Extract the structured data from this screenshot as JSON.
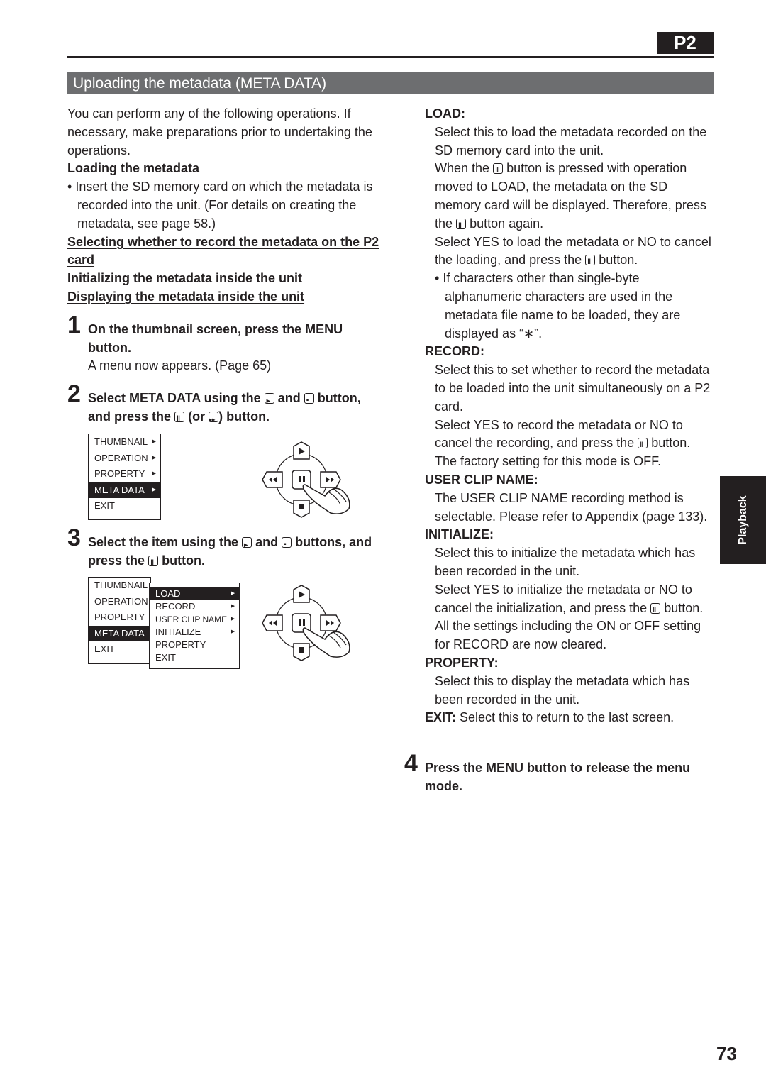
{
  "header": {
    "badge": "P2",
    "section_title": "Uploading the metadata (META DATA)"
  },
  "left": {
    "intro": "You can perform any of the following operations. If necessary, make preparations prior to undertaking the operations.",
    "topics": {
      "loading": "Loading the metadata",
      "loading_bullet": "Insert the SD memory card on which the metadata is recorded into the unit. (For details on creating the metadata, see page 58.)",
      "selecting": "Selecting whether to record the metadata on the P2 card",
      "initializing": "Initializing the metadata inside the unit",
      "displaying": "Displaying the metadata inside the unit"
    },
    "steps": [
      {
        "num": "1",
        "text": "On the thumbnail screen, press the MENU button.",
        "sub": "A menu now appears. (Page 65)"
      },
      {
        "num": "2",
        "text_a": "Select META DATA using the",
        "text_b": "and",
        "text_c": "button, and press the",
        "text_d": "(or",
        "text_e": ") button."
      },
      {
        "num": "3",
        "text_a": "Select the item using the",
        "text_b": "and",
        "text_c": "buttons, and press the",
        "text_d": "button."
      }
    ],
    "menu1": {
      "items": [
        {
          "label": "THUMBNAIL",
          "arrow": "►",
          "selected": false
        },
        {
          "label": "OPERATION",
          "arrow": "►",
          "selected": false
        },
        {
          "label": "PROPERTY",
          "arrow": "►",
          "selected": false
        },
        {
          "label": "META DATA",
          "arrow": "►",
          "selected": true
        },
        {
          "label": "EXIT",
          "arrow": "",
          "selected": false
        }
      ]
    },
    "menu2": {
      "parent": [
        "THUMBNAIL",
        "OPERATION",
        "PROPERTY",
        "META DATA",
        "EXIT"
      ],
      "parent_selected": "META DATA",
      "sub": [
        {
          "label": "LOAD",
          "arrow": "►",
          "selected": true
        },
        {
          "label": "RECORD",
          "arrow": "►",
          "selected": false
        },
        {
          "label": "USER CLIP NAME",
          "arrow": "►",
          "selected": false
        },
        {
          "label": "INITIALIZE",
          "arrow": "►",
          "selected": false
        },
        {
          "label": "PROPERTY",
          "arrow": "",
          "selected": false
        },
        {
          "label": "EXIT",
          "arrow": "",
          "selected": false
        }
      ]
    }
  },
  "right": {
    "load": {
      "label": "LOAD:",
      "p1": "Select this to load the metadata recorded on the SD memory card into the unit.",
      "p2a": "When the",
      "p2b": "button is pressed with operation moved to LOAD, the metadata on the SD memory card will be displayed. Therefore, press the",
      "p2c": "button again.",
      "p3a": "Select YES to load the metadata or NO to cancel the loading, and press the",
      "p3b": "button.",
      "bullet": "If characters other than single-byte alphanumeric characters are used in the metadata file name to be loaded, they are displayed as “∗”."
    },
    "record": {
      "label": "RECORD:",
      "p1": "Select this to set whether to record the metadata to be loaded into the unit simultaneously on a P2 card.",
      "p2a": "Select YES to record the metadata or NO to cancel the recording, and press the",
      "p2b": "button.",
      "p3": "The factory setting for this mode is OFF."
    },
    "user_clip_name": {
      "label": "USER CLIP NAME:",
      "p1": "The USER CLIP NAME recording method is selectable. Please refer to Appendix (page 133)."
    },
    "initialize": {
      "label": "INITIALIZE:",
      "p1": "Select this to initialize the metadata which has been recorded in the unit.",
      "p2a": "Select YES to initialize the metadata or NO to cancel the initialization, and press the",
      "p2b": "button. All the settings including the ON or OFF setting for RECORD are now cleared."
    },
    "property": {
      "label": "PROPERTY:",
      "p1": "Select this to display the metadata which has been recorded in the unit."
    },
    "exit": {
      "label": "EXIT:",
      "p1": "Select this to return to the last screen."
    },
    "step4": {
      "num": "4",
      "text": "Press the MENU button to release the menu mode."
    }
  },
  "side_tab": "Playback",
  "page_number": "73"
}
